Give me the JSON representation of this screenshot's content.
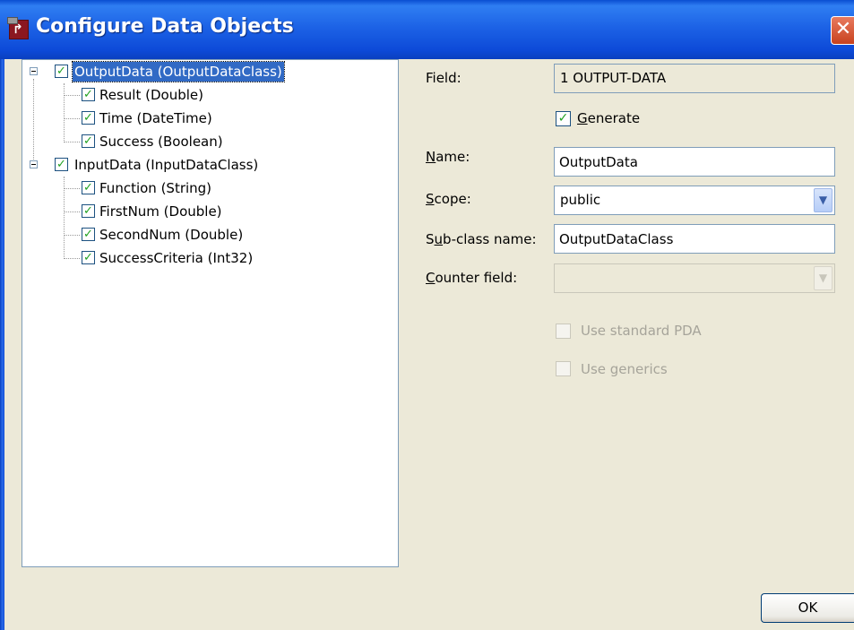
{
  "window": {
    "title": "Configure Data Objects",
    "app_icon": "app-icon",
    "close_glyph": "✕"
  },
  "tree": {
    "nodes": [
      {
        "label": "OutputData (OutputDataClass)",
        "checked": true,
        "selected": true,
        "expanded": true,
        "children": [
          {
            "label": "Result (Double)",
            "checked": true
          },
          {
            "label": "Time (DateTime)",
            "checked": true
          },
          {
            "label": "Success (Boolean)",
            "checked": true
          }
        ]
      },
      {
        "label": "InputData (InputDataClass)",
        "checked": true,
        "selected": false,
        "expanded": true,
        "children": [
          {
            "label": "Function (String)",
            "checked": true
          },
          {
            "label": "FirstNum (Double)",
            "checked": true
          },
          {
            "label": "SecondNum (Double)",
            "checked": true
          },
          {
            "label": "SuccessCriteria (Int32)",
            "checked": true
          }
        ]
      }
    ]
  },
  "form": {
    "field_label": "Field:",
    "field_value": "1 OUTPUT-DATA",
    "generate_label_pre": "",
    "generate_label_key": "G",
    "generate_label_post": "enerate",
    "generate_checked": true,
    "name_label_key": "N",
    "name_label_post": "ame:",
    "name_value": "OutputData",
    "scope_label_key": "S",
    "scope_label_post": "cope:",
    "scope_value": "public",
    "subclass_label_pre": "S",
    "subclass_label_key": "u",
    "subclass_label_post": "b-class name:",
    "subclass_value": "OutputDataClass",
    "counter_label_key": "C",
    "counter_label_post": "ounter field:",
    "counter_value": "",
    "use_standard_pda_label": "Use standard PDA",
    "use_standard_pda_checked": false,
    "use_generics_label": "Use generics",
    "use_generics_checked": false
  },
  "buttons": {
    "ok_label": "OK"
  },
  "colors": {
    "titlebar": "#0a4ed1",
    "selection": "#316ac5",
    "check": "#21a121",
    "dialog_bg": "#ece9d8"
  }
}
